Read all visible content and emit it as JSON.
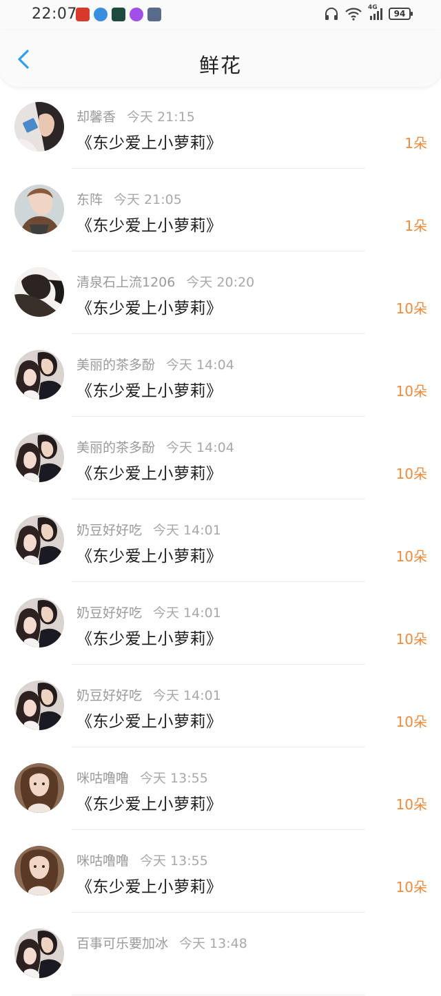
{
  "status_bar": {
    "time": "22:07",
    "network": "4G",
    "battery": "94",
    "icons": [
      "game-app-icon",
      "browser-app-icon",
      "map-app-icon",
      "music-app-icon",
      "game-app-icon-2",
      "headphones-icon",
      "wifi-icon",
      "signal-icon",
      "battery-icon"
    ]
  },
  "header": {
    "title": "鲜花",
    "back_icon": "chevron-left-icon"
  },
  "colors": {
    "accent_blue": "#2aa0f0",
    "count_orange": "#f08a3a",
    "meta_gray": "#9a9a9a"
  },
  "items": [
    {
      "user": "却馨香",
      "time": "今天 21:15",
      "book": "《东少爱上小萝莉》",
      "count": "1朵",
      "avatar": "avatar-girl-phone"
    },
    {
      "user": "东阵",
      "time": "今天 21:05",
      "book": "《东少爱上小萝莉》",
      "count": "1朵",
      "avatar": "avatar-boy"
    },
    {
      "user": "清泉石上流1206",
      "time": "今天 20:20",
      "book": "《东少爱上小萝莉》",
      "count": "10朵",
      "avatar": "avatar-dark-photo"
    },
    {
      "user": "美丽的茶多酚",
      "time": "今天 14:04",
      "book": "《东少爱上小萝莉》",
      "count": "10朵",
      "avatar": "avatar-couple"
    },
    {
      "user": "美丽的茶多酚",
      "time": "今天 14:04",
      "book": "《东少爱上小萝莉》",
      "count": "10朵",
      "avatar": "avatar-couple"
    },
    {
      "user": "奶豆好好吃",
      "time": "今天 14:01",
      "book": "《东少爱上小萝莉》",
      "count": "10朵",
      "avatar": "avatar-couple"
    },
    {
      "user": "奶豆好好吃",
      "time": "今天 14:01",
      "book": "《东少爱上小萝莉》",
      "count": "10朵",
      "avatar": "avatar-couple"
    },
    {
      "user": "奶豆好好吃",
      "time": "今天 14:01",
      "book": "《东少爱上小萝莉》",
      "count": "10朵",
      "avatar": "avatar-couple"
    },
    {
      "user": "咪咕噜噜",
      "time": "今天 13:55",
      "book": "《东少爱上小萝莉》",
      "count": "10朵",
      "avatar": "avatar-girl-portrait"
    },
    {
      "user": "咪咕噜噜",
      "time": "今天 13:55",
      "book": "《东少爱上小萝莉》",
      "count": "10朵",
      "avatar": "avatar-girl-portrait"
    },
    {
      "user": "百事可乐要加冰",
      "time": "今天 13:48",
      "book": "",
      "count": "",
      "avatar": "avatar-couple"
    }
  ]
}
